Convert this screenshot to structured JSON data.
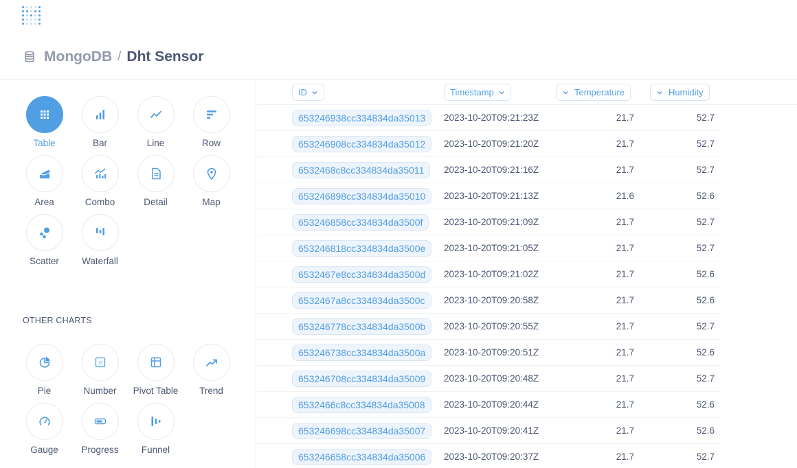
{
  "colors": {
    "brand": "#509ee3",
    "text": "#4c5773",
    "muted": "#949aab"
  },
  "breadcrumb": {
    "database": "MongoDB",
    "separator": "/",
    "table": "Dht Sensor"
  },
  "visualizations": [
    {
      "label": "Table",
      "icon": "table-icon",
      "active": true
    },
    {
      "label": "Bar",
      "icon": "bar-chart-icon"
    },
    {
      "label": "Line",
      "icon": "line-chart-icon"
    },
    {
      "label": "Row",
      "icon": "row-chart-icon"
    },
    {
      "label": "Area",
      "icon": "area-chart-icon"
    },
    {
      "label": "Combo",
      "icon": "combo-chart-icon"
    },
    {
      "label": "Detail",
      "icon": "detail-icon"
    },
    {
      "label": "Map",
      "icon": "map-pin-icon"
    },
    {
      "label": "Scatter",
      "icon": "scatter-icon"
    },
    {
      "label": "Waterfall",
      "icon": "waterfall-icon"
    }
  ],
  "other_charts_title": "OTHER CHARTS",
  "other_charts": [
    {
      "label": "Pie",
      "icon": "pie-chart-icon"
    },
    {
      "label": "Number",
      "icon": "number-icon"
    },
    {
      "label": "Pivot Table",
      "icon": "pivot-table-icon"
    },
    {
      "label": "Trend",
      "icon": "trend-icon"
    },
    {
      "label": "Gauge",
      "icon": "gauge-icon"
    },
    {
      "label": "Progress",
      "icon": "progress-icon"
    },
    {
      "label": "Funnel",
      "icon": "funnel-icon"
    }
  ],
  "table": {
    "columns": [
      "ID",
      "Timestamp",
      "Temperature",
      "Humidity"
    ],
    "rows": [
      [
        "653246938cc334834da35013",
        "2023-10-20T09:21:23Z",
        "21.7",
        "52.7"
      ],
      [
        "653246908cc334834da35012",
        "2023-10-20T09:21:20Z",
        "21.7",
        "52.7"
      ],
      [
        "6532468c8cc334834da35011",
        "2023-10-20T09:21:16Z",
        "21.7",
        "52.7"
      ],
      [
        "653246898cc334834da35010",
        "2023-10-20T09:21:13Z",
        "21.6",
        "52.6"
      ],
      [
        "653246858cc334834da3500f",
        "2023-10-20T09:21:09Z",
        "21.7",
        "52.7"
      ],
      [
        "653246818cc334834da3500e",
        "2023-10-20T09:21:05Z",
        "21.7",
        "52.7"
      ],
      [
        "6532467e8cc334834da3500d",
        "2023-10-20T09:21:02Z",
        "21.7",
        "52.6"
      ],
      [
        "6532467a8cc334834da3500c",
        "2023-10-20T09:20:58Z",
        "21.7",
        "52.6"
      ],
      [
        "653246778cc334834da3500b",
        "2023-10-20T09:20:55Z",
        "21.7",
        "52.7"
      ],
      [
        "653246738cc334834da3500a",
        "2023-10-20T09:20:51Z",
        "21.7",
        "52.6"
      ],
      [
        "653246708cc334834da35009",
        "2023-10-20T09:20:48Z",
        "21.7",
        "52.7"
      ],
      [
        "6532466c8cc334834da35008",
        "2023-10-20T09:20:44Z",
        "21.7",
        "52.6"
      ],
      [
        "653246698cc334834da35007",
        "2023-10-20T09:20:41Z",
        "21.7",
        "52.6"
      ],
      [
        "653246658cc334834da35006",
        "2023-10-20T09:20:37Z",
        "21.7",
        "52.7"
      ]
    ]
  }
}
